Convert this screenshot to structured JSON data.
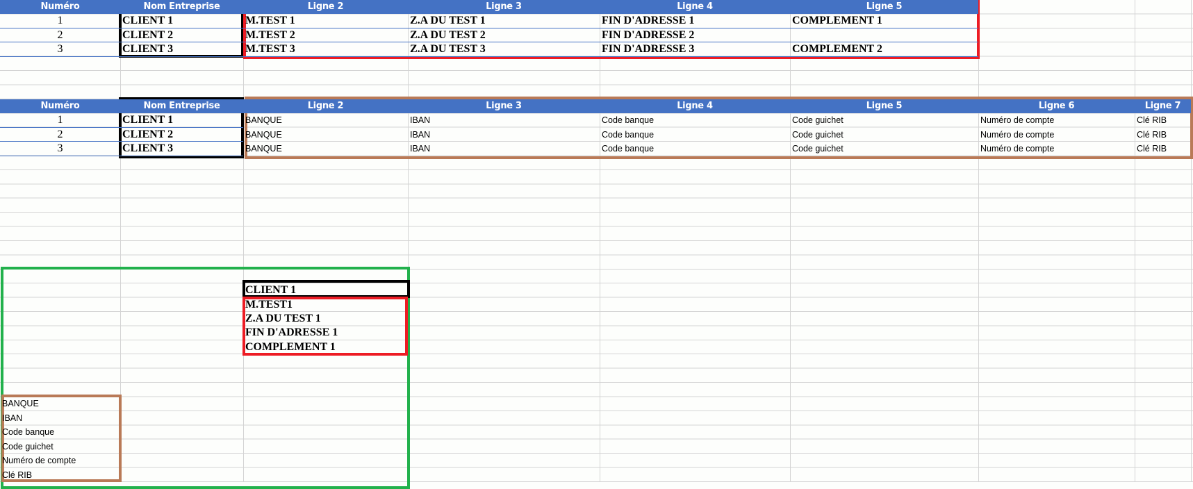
{
  "colors": {
    "header_bg": "#4472c4",
    "client_box": "#000000",
    "address_box": "#ed1c24",
    "bank_box": "#b97a57",
    "merge_box": "#22b14c"
  },
  "table1": {
    "headers": [
      "Numéro",
      "Nom Entreprise",
      "Ligne 2",
      "Ligne 3",
      "Ligne 4",
      "Ligne 5"
    ],
    "rows": [
      [
        "1",
        "CLIENT 1",
        "M.TEST 1",
        "Z.A DU TEST 1",
        "FIN D'ADRESSE 1",
        "COMPLEMENT 1"
      ],
      [
        "2",
        "CLIENT 2",
        "M.TEST 2",
        "Z.A DU TEST 2",
        "FIN D'ADRESSE 2",
        ""
      ],
      [
        "3",
        "CLIENT 3",
        "M.TEST 3",
        "Z.A DU TEST 3",
        "FIN D'ADRESSE 3",
        "COMPLEMENT 2"
      ]
    ]
  },
  "table2": {
    "headers": [
      "Numéro",
      "Nom Entreprise",
      "Ligne 2",
      "Ligne 3",
      "Ligne 4",
      "Ligne 5",
      "Ligne 6",
      "Ligne 7"
    ],
    "rows": [
      [
        "1",
        "CLIENT 1",
        "BANQUE",
        "IBAN",
        "Code banque",
        "Code guichet",
        "Numéro de compte",
        "Clé RIB"
      ],
      [
        "2",
        "CLIENT 2",
        "BANQUE",
        "IBAN",
        "Code banque",
        "Code guichet",
        "Numéro de compte",
        "Clé RIB"
      ],
      [
        "3",
        "CLIENT 3",
        "BANQUE",
        "IBAN",
        "Code banque",
        "Code guichet",
        "Numéro de compte",
        "Clé RIB"
      ]
    ]
  },
  "merged": {
    "client": "CLIENT 1",
    "address": [
      "M.TEST1",
      "Z.A DU TEST 1",
      "FIN D'ADRESSE 1",
      "COMPLEMENT 1"
    ],
    "bank": [
      "BANQUE",
      "IBAN",
      "Code banque",
      "Code guichet",
      "Numéro de compte",
      "Clé RIB"
    ]
  }
}
